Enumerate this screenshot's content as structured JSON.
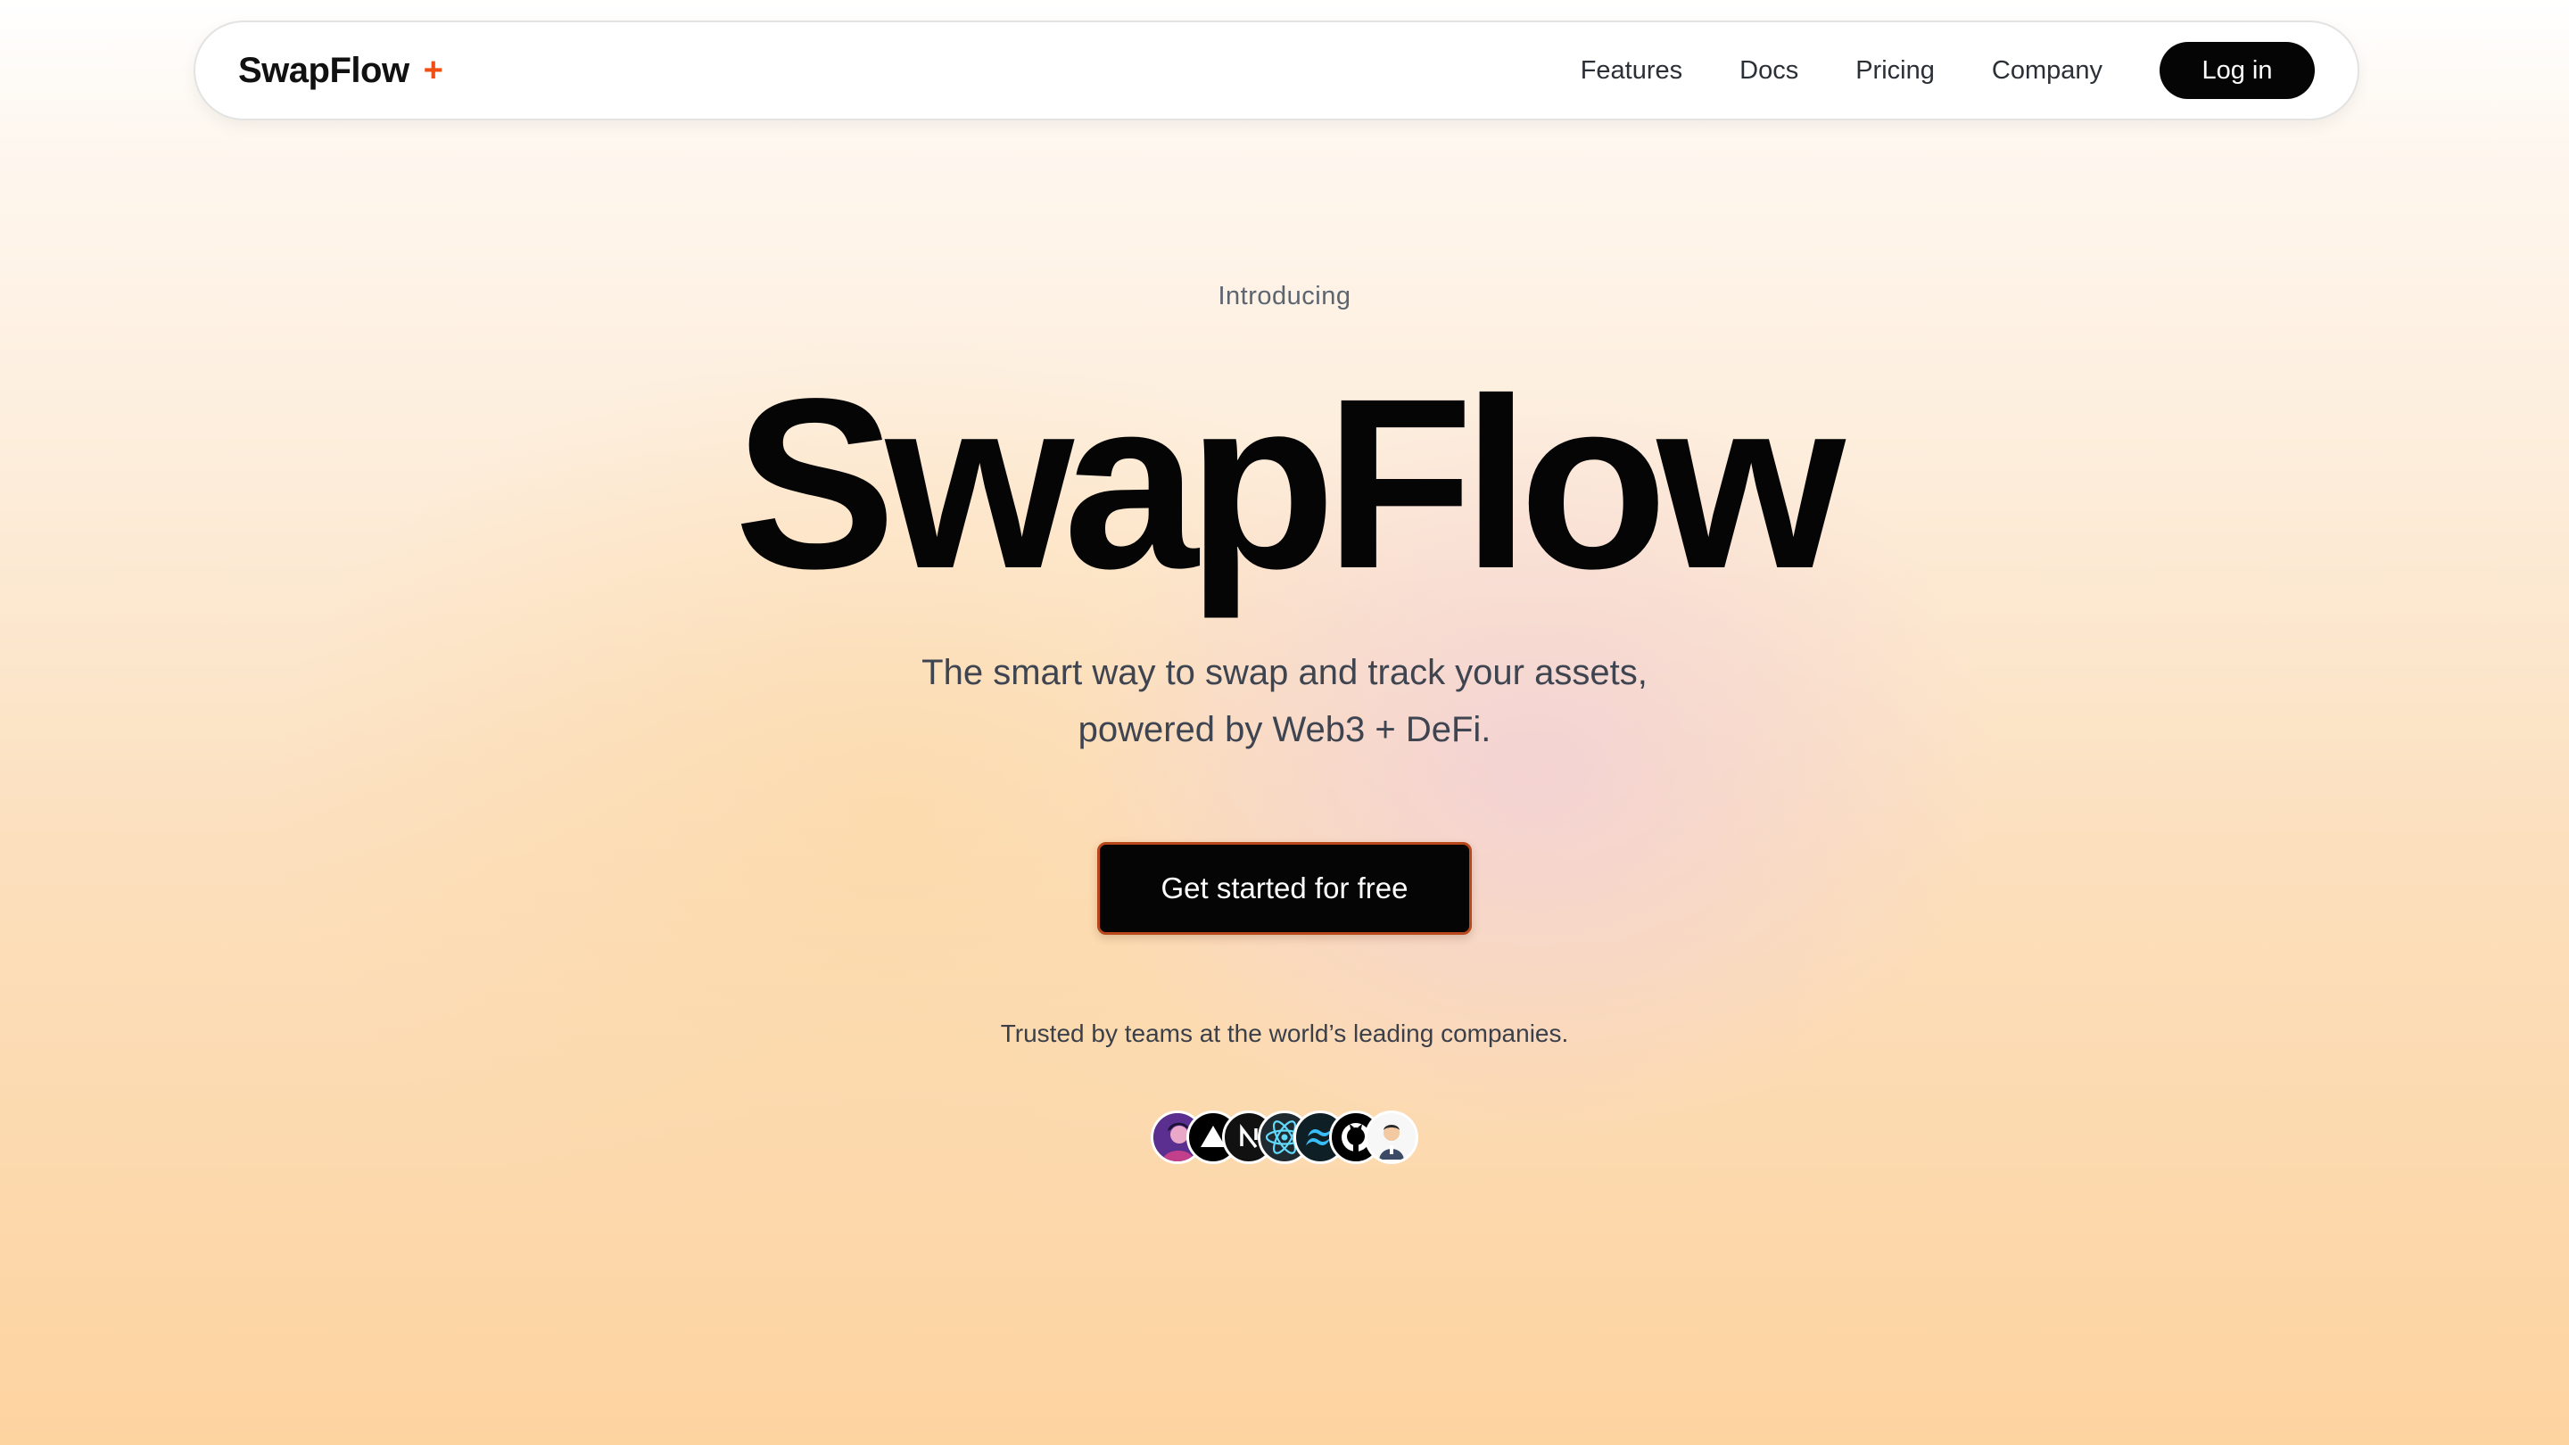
{
  "nav": {
    "brand": "SwapFlow",
    "brand_mark": "+",
    "links": [
      {
        "label": "Features"
      },
      {
        "label": "Docs"
      },
      {
        "label": "Pricing"
      },
      {
        "label": "Company"
      }
    ],
    "login_label": "Log in"
  },
  "hero": {
    "eyebrow": "Introducing",
    "title": "SwapFlow",
    "subtitle_line1": "The smart way to swap and track your assets,",
    "subtitle_line2": "powered by Web3 + DeFi.",
    "cta_label": "Get started for free",
    "trusted_text": "Trusted by teams at the world’s leading companies."
  },
  "logos": [
    {
      "name": "user-avatar-icon",
      "bg": "#3b2a6b"
    },
    {
      "name": "vercel-logo-icon",
      "bg": "#000000"
    },
    {
      "name": "nextjs-logo-icon",
      "bg": "#111111",
      "letter": "N"
    },
    {
      "name": "react-logo-icon",
      "bg": "#1f2a30",
      "accent": "#61dafb"
    },
    {
      "name": "tailwind-logo-icon",
      "bg": "#0f1f26",
      "accent": "#38bdf8"
    },
    {
      "name": "github-logo-icon",
      "bg": "#000000"
    },
    {
      "name": "memoji-avatar-icon",
      "bg": "#f4f4f4"
    }
  ],
  "colors": {
    "accent": "#f04e12",
    "button_dark": "#050505",
    "cta_border": "#b8481c"
  }
}
